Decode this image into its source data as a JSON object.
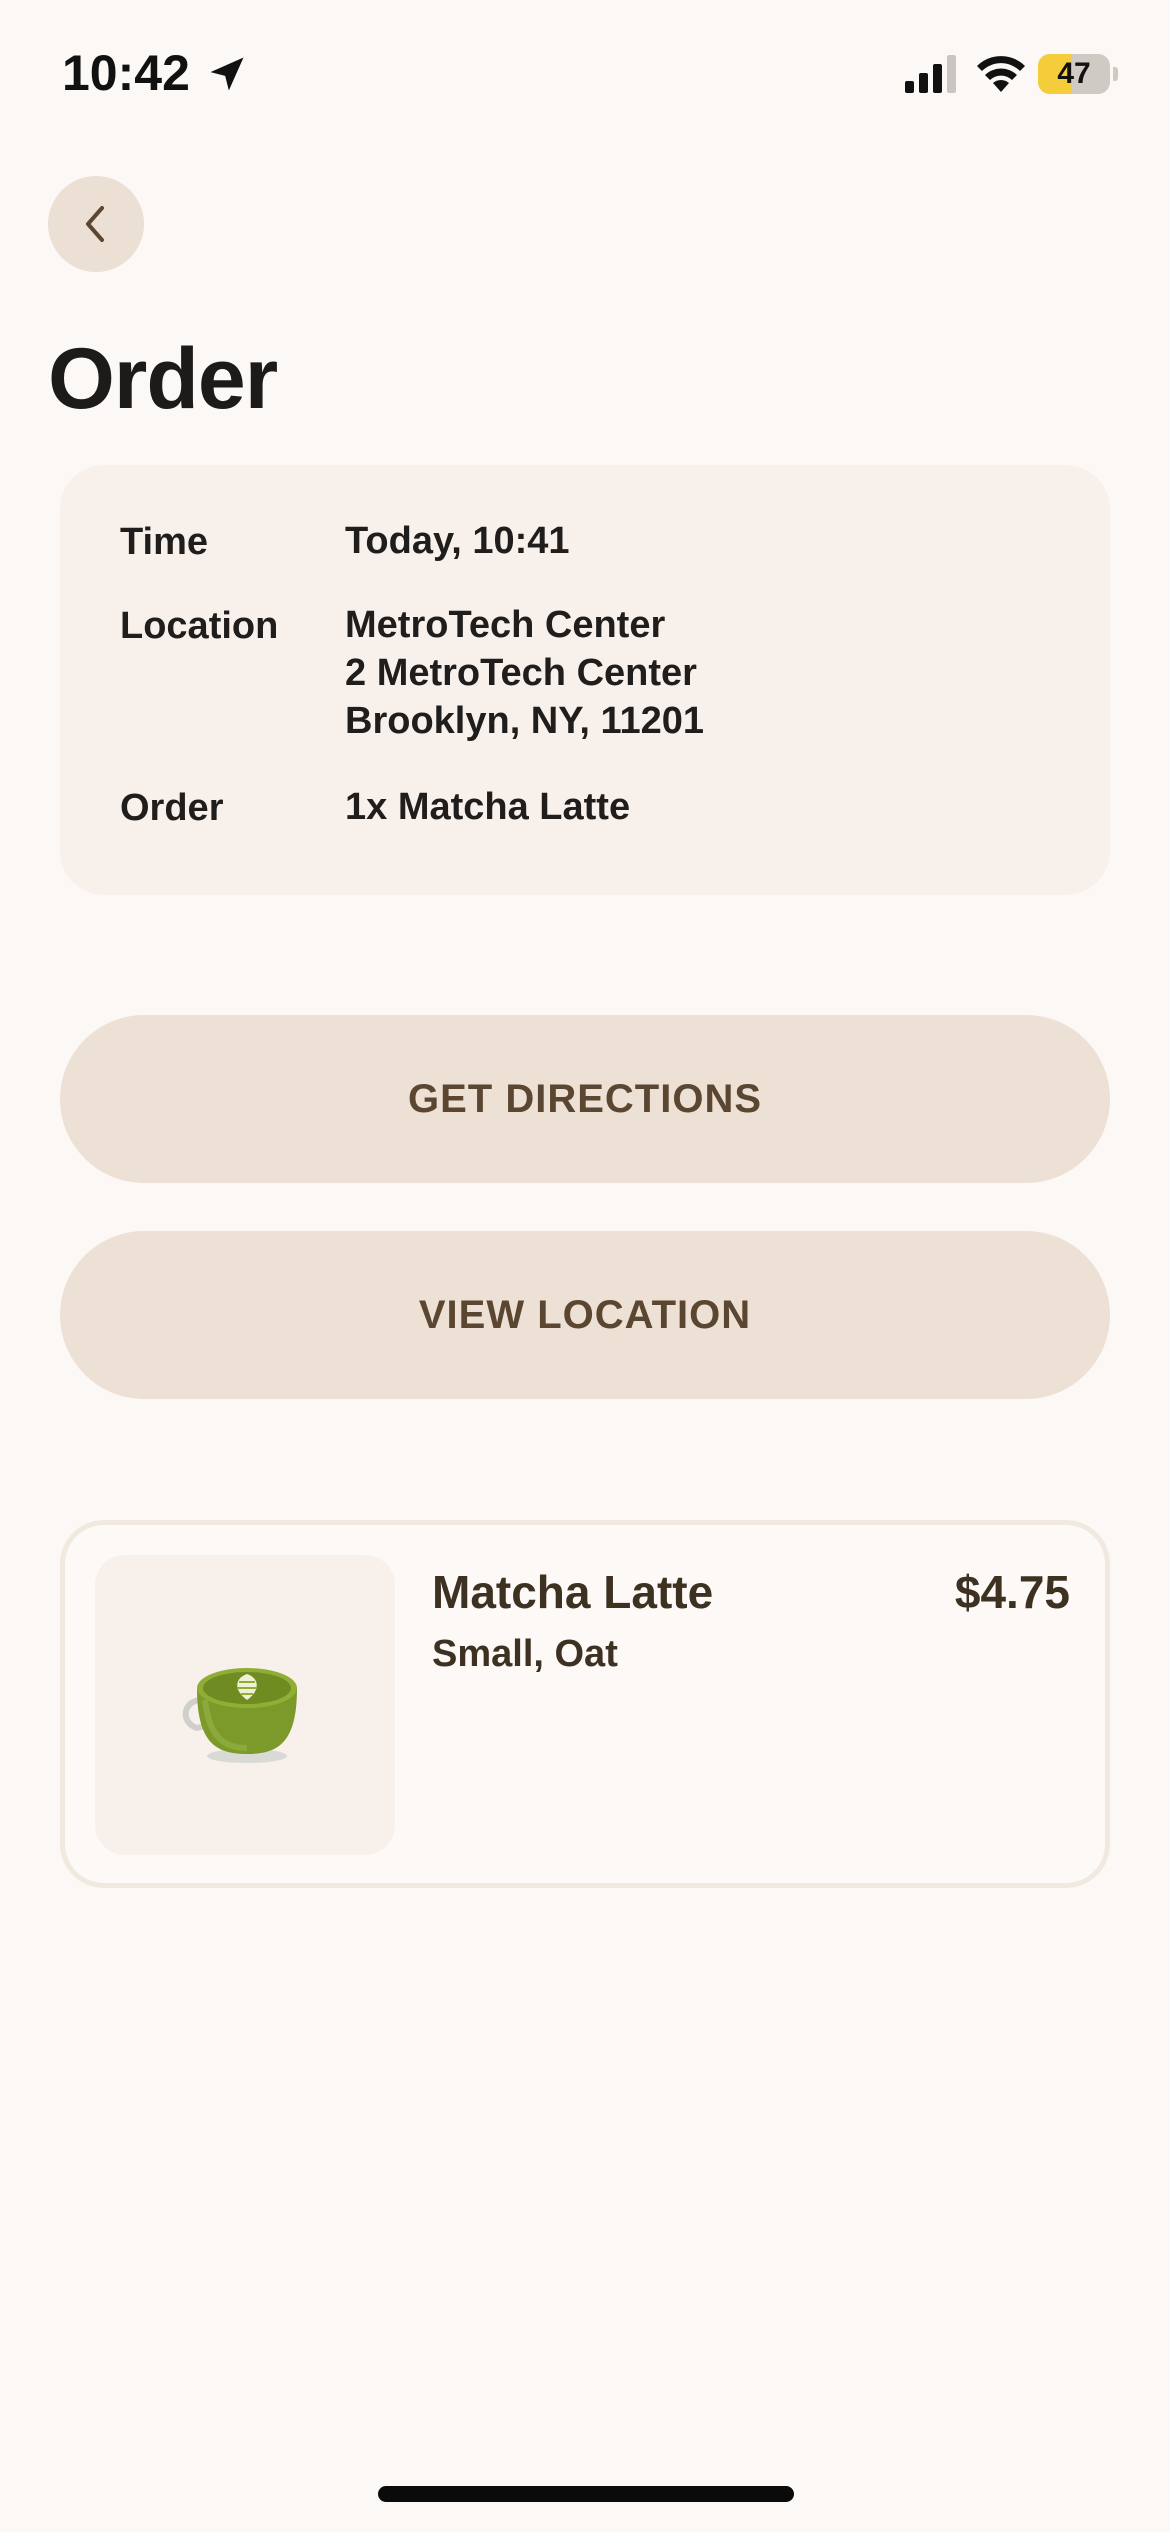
{
  "status_bar": {
    "time": "10:42",
    "battery_level": "47",
    "battery_fraction": 0.47,
    "icons": [
      "location-arrow-icon",
      "cellular-signal-icon",
      "wifi-icon",
      "battery-icon"
    ]
  },
  "header": {
    "back_icon": "chevron-left-icon",
    "title": "Order"
  },
  "details": {
    "time_label": "Time",
    "time_value": "Today, 10:41",
    "location_label": "Location",
    "location_lines": [
      "MetroTech Center",
      "2 MetroTech Center",
      "Brooklyn, NY, 11201"
    ],
    "order_label": "Order",
    "order_value": "1x Matcha Latte"
  },
  "actions": {
    "directions_label": "GET DIRECTIONS",
    "view_location_label": "VIEW LOCATION"
  },
  "item": {
    "name": "Matcha Latte",
    "options": "Small, Oat",
    "price": "$4.75",
    "image": "matcha-latte-cup-icon"
  },
  "colors": {
    "background": "#fcf8f5",
    "card_background": "#f8f0eb",
    "button_background": "#ede0d4",
    "button_text": "#5a4631",
    "battery_fill": "#f5cc3a"
  }
}
